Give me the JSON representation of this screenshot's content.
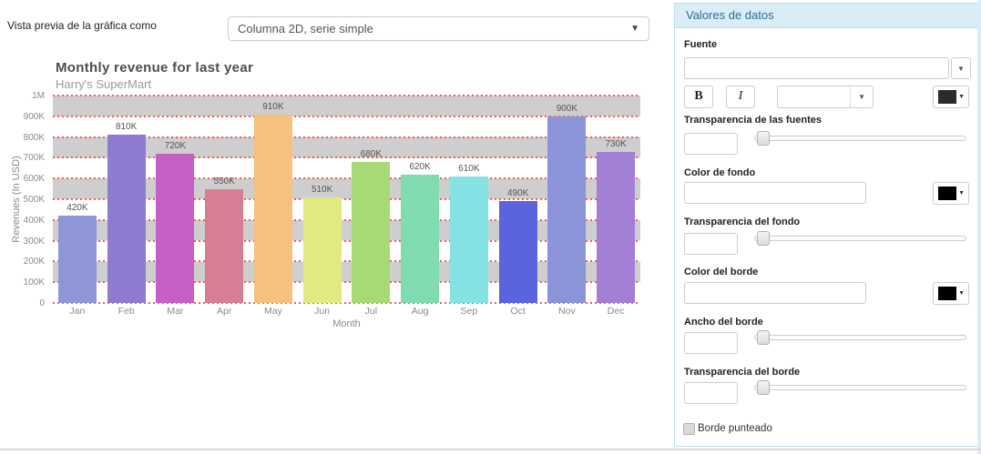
{
  "preview_bar": {
    "label": "Vista previa de la gráfica como",
    "chart_type_value": "Columna 2D, serie simple"
  },
  "chart_data": {
    "type": "bar",
    "title": "Monthly revenue for last year",
    "subtitle": "Harry's SuperMart",
    "xlabel": "Month",
    "ylabel": "Revenues (In USD)",
    "categories": [
      "Jan",
      "Feb",
      "Mar",
      "Apr",
      "May",
      "Jun",
      "Jul",
      "Aug",
      "Sep",
      "Oct",
      "Nov",
      "Dec"
    ],
    "values": [
      420000,
      810000,
      720000,
      550000,
      910000,
      510000,
      680000,
      620000,
      610000,
      490000,
      900000,
      730000
    ],
    "value_labels": [
      "420K",
      "810K",
      "720K",
      "550K",
      "910K",
      "510K",
      "680K",
      "620K",
      "610K",
      "490K",
      "900K",
      "730K"
    ],
    "bar_colors": [
      "#8e96d8",
      "#8f7ad2",
      "#c55ec5",
      "#d67f92",
      "#f6c17f",
      "#e2e980",
      "#a6da74",
      "#7fdcb0",
      "#85e2e2",
      "#5a64dc",
      "#8b93d9",
      "#a17fd5"
    ],
    "ylim": [
      0,
      1000000
    ],
    "y_ticks": [
      "1M",
      "900K",
      "800K",
      "700K",
      "600K",
      "500K",
      "400K",
      "300K",
      "200K",
      "100K",
      "0"
    ],
    "grid": true,
    "gridline_color": "#ee5f5b",
    "band_color": "#cecece",
    "legend_position": "none"
  },
  "panel": {
    "title": "Valores de datos",
    "font_section_label": "Fuente",
    "font_family_value": "",
    "bold_button_label": "B",
    "italic_button_label": "I",
    "font_size_value": "",
    "font_color_swatch": "#2b2b2b",
    "font_transparency_label": "Transparencia de las fuentes",
    "font_transparency_value": "",
    "background_color_label": "Color de fondo",
    "background_color_value": "",
    "background_color_swatch": "#000000",
    "background_transparency_label": "Transparencia del fondo",
    "background_transparency_value": "",
    "border_color_label": "Color del borde",
    "border_color_value": "",
    "border_color_swatch": "#000000",
    "border_width_label": "Ancho del borde",
    "border_width_value": "",
    "border_transparency_label": "Transparencia del borde",
    "border_transparency_value": "",
    "dotted_border_label": "Borde punteado",
    "caret_glyph": "▼"
  }
}
